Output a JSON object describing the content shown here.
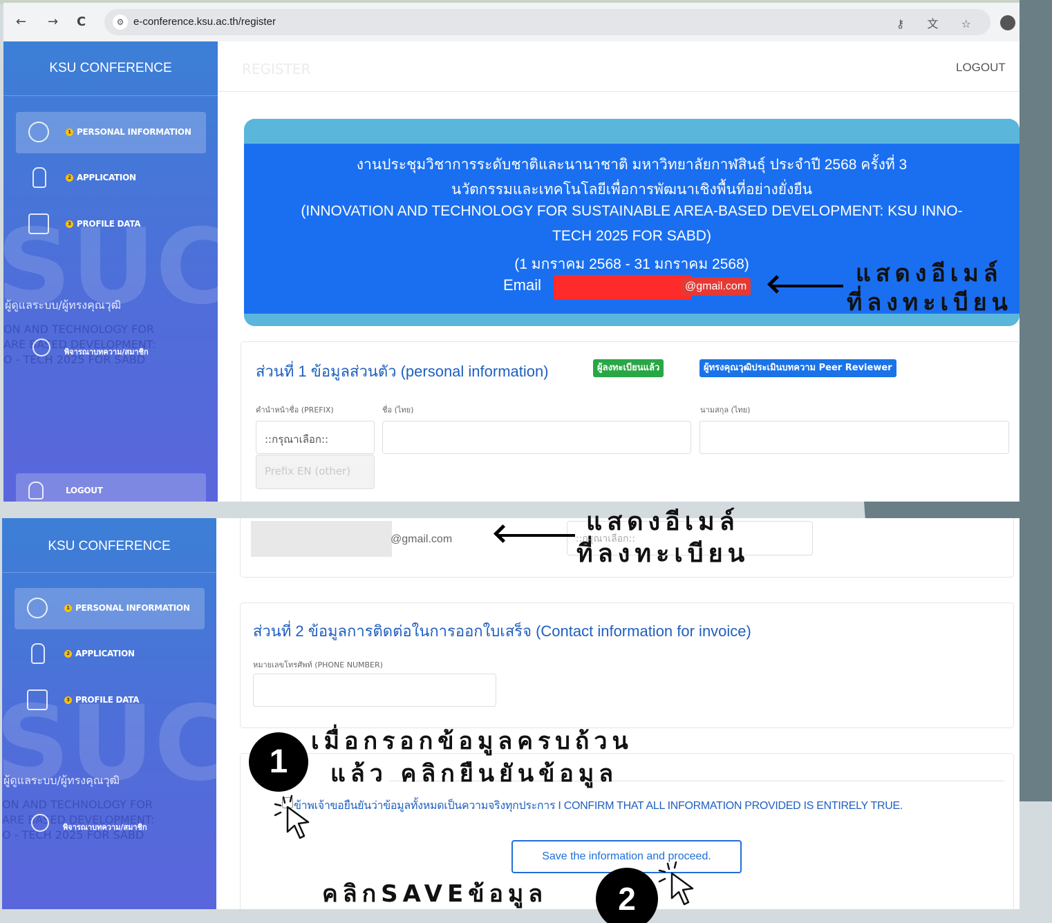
{
  "browser": {
    "url": "e-conference.ksu.ac.th/register",
    "back_icon": "←",
    "forward_icon": "→",
    "reload_icon": "C",
    "tune_icon": "⚙",
    "toolbar_icons": "⚷ 文 ☆"
  },
  "sidebar": {
    "brand": "KSU CONFERENCE",
    "items": [
      {
        "num": "1",
        "label": "PERSONAL INFORMATION"
      },
      {
        "num": "2",
        "label": "APPLICATION"
      },
      {
        "num": "3",
        "label": "PROFILE DATA"
      }
    ],
    "watermark": "SUC",
    "user_role": "ผู้ดูแลระบบ/ผู้ทรงคุณวุฒิ",
    "faded_line1": "ON AND TECHNOLOGY FOR",
    "faded_line2": "ARE  BASED DEVELOPMENT:",
    "faded_line3": "O - TECH 2025 FOR SABD",
    "reviewer_label": "พิจารณาบทความ/สมาชิก",
    "logout": "LOGOUT"
  },
  "topbar": {
    "title": "REGISTER",
    "logout": "LOGOUT"
  },
  "banner": {
    "line1": "งานประชุมวิชาการระดับชาติและนานาชาติ มหาวิทยาลัยกาฬสินธุ์ ประจำปี 2568 ครั้งที่ 3",
    "line2": "นวัตกรรมและเทคโนโลยีเพื่อการพัฒนาเชิงพื้นที่อย่างยั่งยืน",
    "line3": "(INNOVATION AND TECHNOLOGY FOR SUSTAINABLE AREA-BASED DEVELOPMENT: KSU INNO-",
    "line4": "TECH 2025 FOR SABD)",
    "line5": "(1 มกราคม 2568 - 31 มกราคม 2568)",
    "email_label": "Email",
    "email_suffix": "@gmail.com"
  },
  "section1": {
    "title": "ส่วนที่ 1 ข้อมูลส่วนตัว (personal information)",
    "badge_registered": "ผู้ลงทะเบียนแล้ว",
    "badge_reviewer": "ผู้ทรงคุณวุฒิประเมินบทความ Peer Reviewer",
    "prefix_label": "คำนำหน้าชื่อ (PREFIX)",
    "firstname_label": "ชื่อ (ไทย)",
    "lastname_label": "นามสกุล (ไทย)",
    "prefix_value": "::กรุณาเลือก::",
    "prefix_en_placeholder": "Prefix EN (other)"
  },
  "panel2_top": {
    "email_value": "@gmail.com",
    "select_value": "::กรุณาเลือก::"
  },
  "section2": {
    "title": "ส่วนที่ 2 ข้อมูลการติดต่อในการออกใบเสร็จ (Contact information for invoice)",
    "phone_label": "หมายเลขโทรศัพท์ (PHONE NUMBER)"
  },
  "confirm": {
    "text": "ข้าพเจ้าขอยืนยันว่าข้อมูลทั้งหมดเป็นความจริงทุกประการ I CONFIRM THAT ALL INFORMATION PROVIDED IS ENTIRELY TRUE.",
    "save_button": "Save the information and proceed."
  },
  "annotations": {
    "show_email_line1": "แสดงอีเมล์",
    "show_email_line2": "ที่ลงทะเบียน",
    "step1_num": "1",
    "step1_line1": "เมื่อกรอกข้อมูลครบถ้วน",
    "step1_line2": "แล้ว คลิกยืนยันข้อมูล",
    "step2_num": "2",
    "step2_text": "คลิกSAVEข้อมูล"
  },
  "colors": {
    "sidebar": "#4f6ed9",
    "banner": "#1a6ff0",
    "badge_green": "#28a745",
    "badge_blue": "#1a73e8",
    "email_red": "#e53935",
    "link_blue": "#1f5fbf"
  }
}
